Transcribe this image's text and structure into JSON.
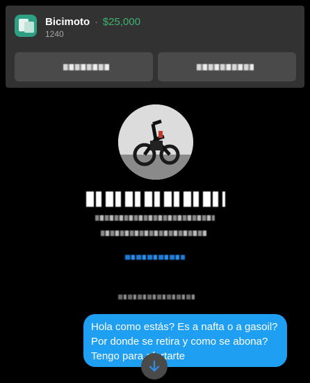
{
  "listing": {
    "title": "Bicimoto",
    "separator": "·",
    "price": "$25,000",
    "subtitle": "1240",
    "thumbnail_icon": "marketplace-listing-icon",
    "accent_color": "#3cb371"
  },
  "actions": [
    {
      "label_redacted": true
    },
    {
      "label_redacted": true
    }
  ],
  "profile": {
    "avatar_icon": "profile-photo-bike",
    "name_redacted": true
  },
  "message": {
    "text": "Hola como estás? Es a nafta o a gasoil? Por donde se retira y como se abona? Tengo para ofertarte",
    "bubble_color": "#1f9ff2"
  },
  "scroll_button": {
    "icon": "arrow-down-icon"
  }
}
